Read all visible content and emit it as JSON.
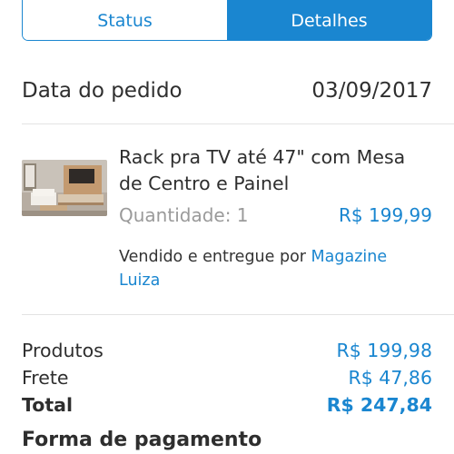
{
  "tabs": {
    "status_label": "Status",
    "details_label": "Detalhes",
    "active": "Detalhes"
  },
  "order": {
    "date_label": "Data do pedido",
    "date_value": "03/09/2017"
  },
  "product": {
    "title": "Rack pra TV até 47\" com Mesa de Centro e Painel",
    "quantity_text": "Quantidade: 1",
    "price": "R$ 199,99",
    "seller_prefix": "Vendido e entregue por ",
    "seller_name": "Magazine Luiza"
  },
  "totals": {
    "products_label": "Produtos",
    "products_value": "R$ 199,98",
    "shipping_label": "Frete",
    "shipping_value": "R$ 47,86",
    "total_label": "Total",
    "total_value": "R$ 247,84"
  },
  "payment": {
    "title": "Forma de pagamento"
  },
  "colors": {
    "accent": "#1a86d0",
    "secondary_text": "#9a9a9a",
    "divider": "#e3e3e3"
  }
}
